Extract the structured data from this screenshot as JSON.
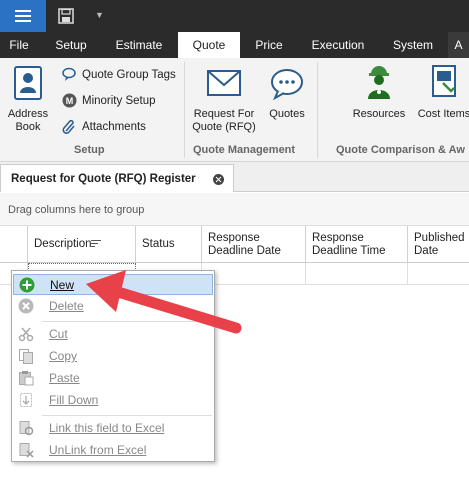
{
  "toolbar": {
    "menu_icon": "hamburger-icon",
    "save_icon": "save-icon",
    "dropdown_glyph": "▼"
  },
  "menu": {
    "tabs": [
      "File",
      "Setup",
      "Estimate",
      "Quote",
      "Price",
      "Execution",
      "System",
      "A"
    ],
    "active": "Quote"
  },
  "ribbon": {
    "setup": {
      "address_book_line1": "Address",
      "address_book_line2": "Book",
      "quote_group_tags": "Quote Group Tags",
      "minority_setup": "Minority Setup",
      "attachments": "Attachments",
      "label": "Setup"
    },
    "quote_management": {
      "rfq_line1": "Request For",
      "rfq_line2": "Quote (RFQ)",
      "quotes": "Quotes",
      "label": "Quote Management"
    },
    "quote_comparison": {
      "resources": "Resources",
      "cost_items": "Cost Items",
      "label": "Quote Comparison & Aw"
    }
  },
  "document": {
    "tab_title": "Request for Quote (RFQ) Register"
  },
  "grid": {
    "group_hint": "Drag columns here to group",
    "columns": {
      "description": "Description",
      "status": "Status",
      "response_deadline_date_l1": "Response",
      "response_deadline_date_l2": "Deadline Date",
      "response_deadline_time_l1": "Response",
      "response_deadline_time_l2": "Deadline Time",
      "published_date_l1": "Published",
      "published_date_l2": "Date"
    }
  },
  "context_menu": {
    "new": "New",
    "delete": "Delete",
    "cut": "Cut",
    "copy": "Copy",
    "paste": "Paste",
    "fill_down": "Fill Down",
    "link_excel": "Link this field to Excel",
    "unlink_excel": "UnLink from Excel"
  },
  "colors": {
    "accent": "#2b72c4",
    "titlebar": "#2b2b2b",
    "highlight": "#cfe3f8",
    "arrow": "#e8414a"
  }
}
